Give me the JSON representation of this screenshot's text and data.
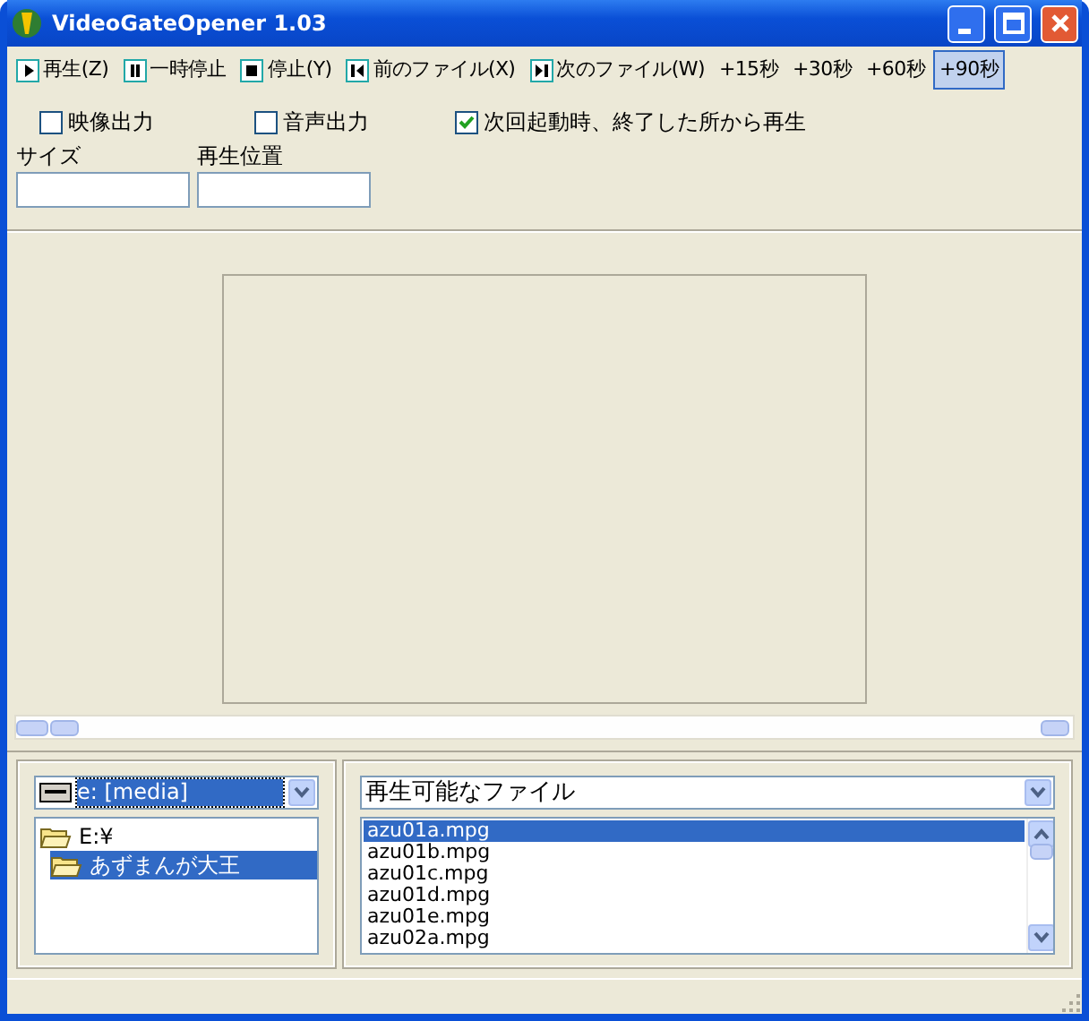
{
  "window": {
    "title": "VideoGateOpener 1.03"
  },
  "toolbar": [
    {
      "label": "再生(Z)",
      "kind": "play",
      "selected": false
    },
    {
      "label": "一時停止",
      "kind": "pause",
      "selected": false
    },
    {
      "label": "停止(Y)",
      "kind": "stop",
      "selected": false
    },
    {
      "label": "前のファイル(X)",
      "kind": "prev",
      "selected": false
    },
    {
      "label": "次のファイル(W)",
      "kind": "next",
      "selected": false
    },
    {
      "label": "+15秒",
      "kind": "plain",
      "selected": false
    },
    {
      "label": "+30秒",
      "kind": "plain",
      "selected": false
    },
    {
      "label": "+60秒",
      "kind": "plain",
      "selected": false
    },
    {
      "label": "+90秒",
      "kind": "plain",
      "selected": true
    }
  ],
  "options": [
    {
      "label": "映像出力",
      "checked": false
    },
    {
      "label": "音声出力",
      "checked": false
    },
    {
      "label": "次回起動時、終了した所から再生",
      "checked": true
    }
  ],
  "fields": [
    {
      "label": "サイズ"
    },
    {
      "label": "再生位置"
    }
  ],
  "drive": {
    "value": "e: [media]"
  },
  "folders": [
    {
      "label": "E:¥",
      "selected": false,
      "children": [
        {
          "label": "あずまんが大王",
          "selected": true
        }
      ]
    }
  ],
  "filter": {
    "value": "再生可能なファイル"
  },
  "files": [
    {
      "name": "azu01a.mpg",
      "selected": true
    },
    {
      "name": "azu01b.mpg",
      "selected": false
    },
    {
      "name": "azu01c.mpg",
      "selected": false
    },
    {
      "name": "azu01d.mpg",
      "selected": false
    },
    {
      "name": "azu01e.mpg",
      "selected": false
    },
    {
      "name": "azu02a.mpg",
      "selected": false
    }
  ]
}
